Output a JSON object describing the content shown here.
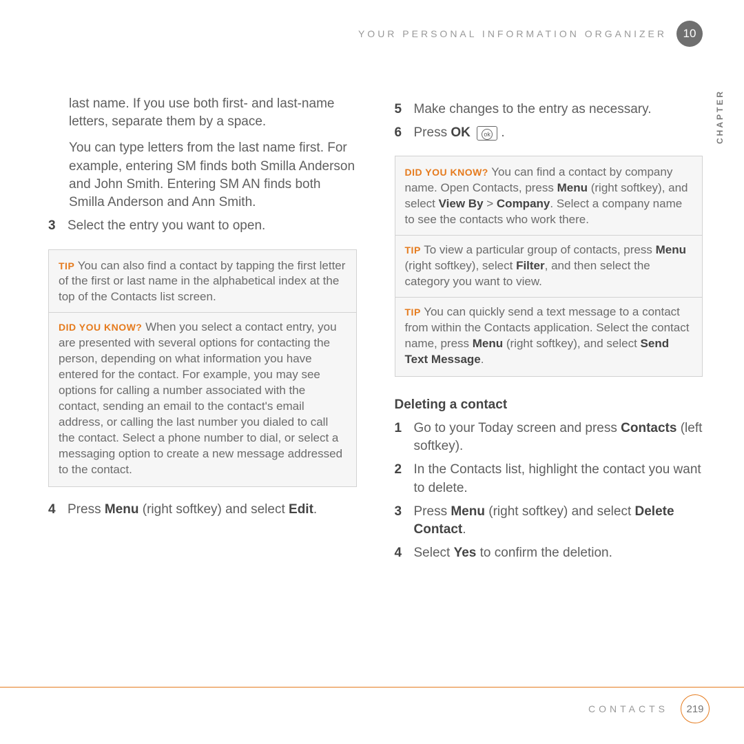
{
  "header": {
    "running_head": "YOUR PERSONAL INFORMATION ORGANIZER",
    "chapter_number": "10",
    "chapter_side_label": "CHAPTER"
  },
  "left": {
    "para1": "last name. If you use both first- and last-name letters, separate them by a space.",
    "para2": "You can type letters from the last name first. For example, entering SM finds both Smilla Anderson and John Smith. Entering SM AN finds both Smilla Anderson and Ann Smith.",
    "step3_num": "3",
    "step3_text": "Select the entry you want to open.",
    "tip_label": "TIP",
    "tip_text": " You can also find a contact by tapping the first letter of the first or last name in the alphabetical index at the top of the Contacts list screen.",
    "dyk_label": "DID YOU KNOW?",
    "dyk_text": " When you select a contact entry, you are presented with several options for contacting the person, depending on what information you have entered for the contact. For example, you may see options for calling a number associated with the contact, sending an email to the contact's email address, or calling the last number you dialed to call the contact. Select a phone number to dial, or select a messaging option to create a new message addressed to the contact.",
    "step4_num": "4",
    "step4_a": "Press ",
    "step4_menu": "Menu",
    "step4_b": " (right softkey) and select ",
    "step4_edit": "Edit",
    "step4_c": "."
  },
  "right": {
    "step5_num": "5",
    "step5_text": "Make changes to the entry as necessary.",
    "step6_num": "6",
    "step6_a": "Press ",
    "step6_ok": "OK",
    "step6_icon_inner": "ok",
    "step6_b": " .",
    "dyk_label": "DID YOU KNOW?",
    "dyk_a": " You can find a contact by company name. Open Contacts, press ",
    "dyk_menu": "Menu",
    "dyk_b": " (right softkey), and select ",
    "dyk_viewby": "View By",
    "dyk_c": " > ",
    "dyk_company": "Company",
    "dyk_d": ". Select a company name to see the contacts who work there.",
    "tip1_label": "TIP",
    "tip1_a": " To view a particular group of contacts, press ",
    "tip1_menu": "Menu",
    "tip1_b": " (right softkey), select ",
    "tip1_filter": "Filter",
    "tip1_c": ", and then select the category you want to view.",
    "tip2_label": "TIP",
    "tip2_a": " You can quickly send a text message to a contact from within the Contacts application. Select the contact name, press ",
    "tip2_menu": "Menu",
    "tip2_b": " (right softkey), and select ",
    "tip2_send": "Send Text Message",
    "tip2_c": ".",
    "heading": "Deleting a contact",
    "d1_num": "1",
    "d1_a": "Go to your Today screen and press ",
    "d1_contacts": "Contacts",
    "d1_b": " (left softkey).",
    "d2_num": "2",
    "d2_text": "In the Contacts list, highlight the contact you want to delete.",
    "d3_num": "3",
    "d3_a": "Press ",
    "d3_menu": "Menu",
    "d3_b": " (right softkey) and select ",
    "d3_delete": "Delete Contact",
    "d3_c": ".",
    "d4_num": "4",
    "d4_a": "Select ",
    "d4_yes": "Yes",
    "d4_b": " to confirm the deletion."
  },
  "footer": {
    "section": "CONTACTS",
    "page": "219"
  }
}
